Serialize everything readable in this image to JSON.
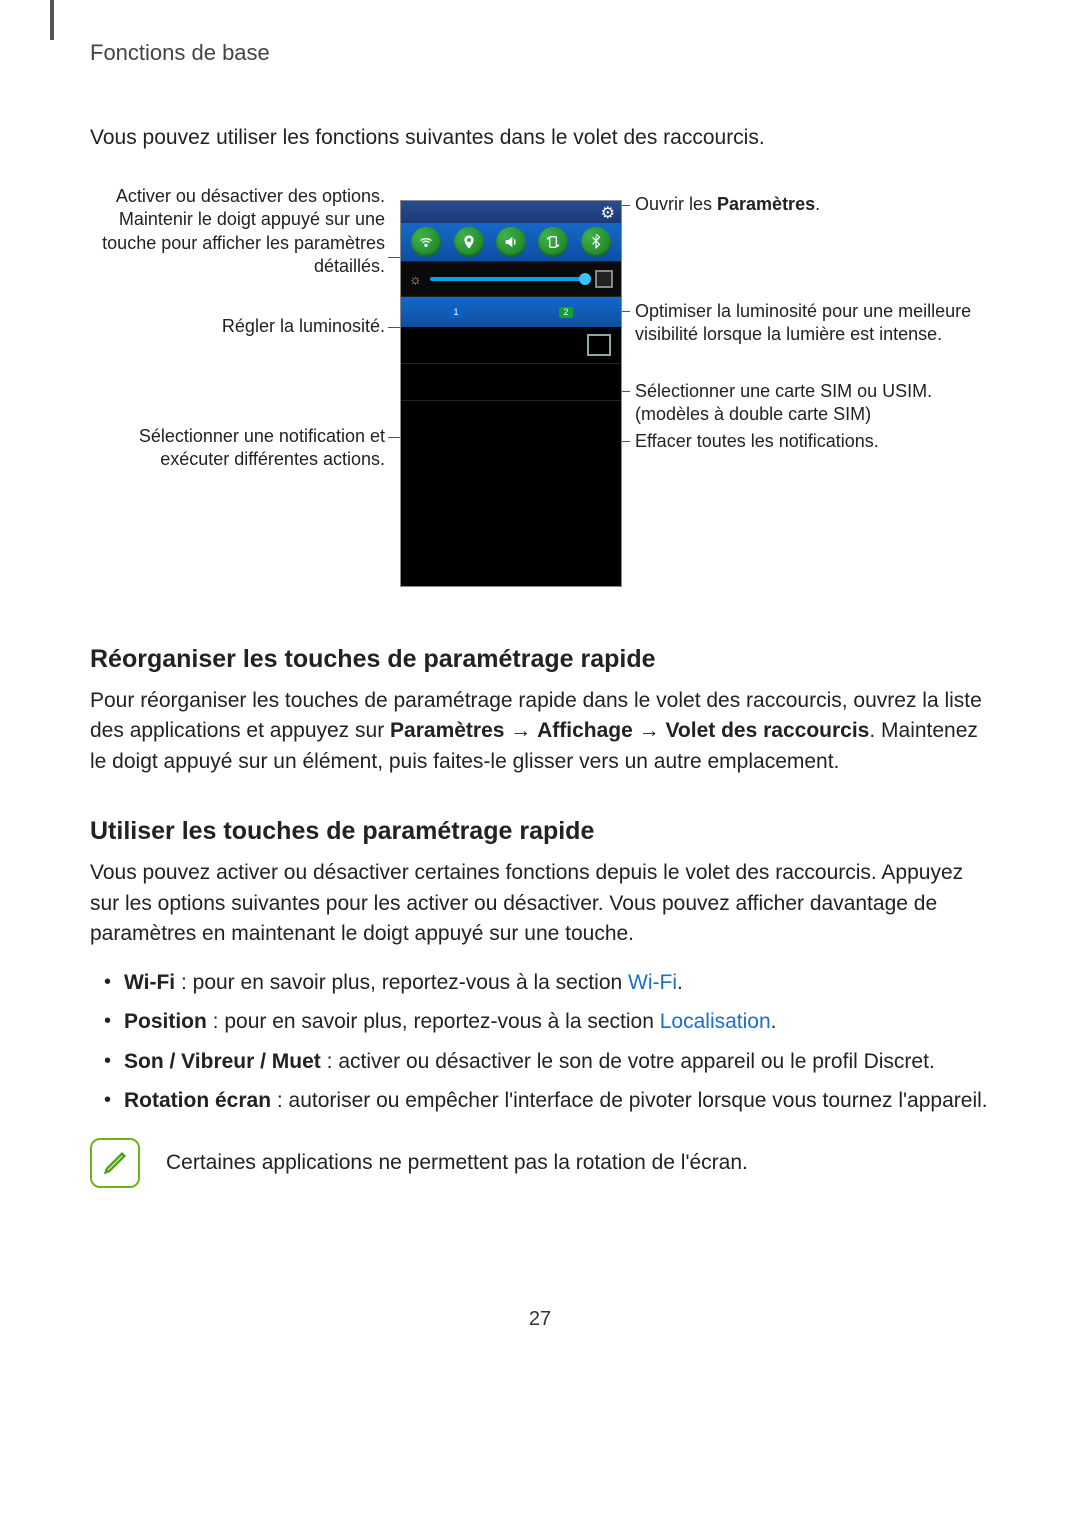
{
  "header": "Fonctions de base",
  "intro": "Vous pouvez utiliser les fonctions suivantes dans le volet des raccourcis.",
  "callouts": {
    "left_toggles": "Activer ou désactiver des options. Maintenir le doigt appuyé sur une touche pour afficher les paramètres détaillés.",
    "left_brightness": "Régler la luminosité.",
    "left_notif": "Sélectionner une notification et exécuter différentes actions.",
    "right_settings_pre": "Ouvrir les ",
    "right_settings_strong": "Paramètres",
    "right_settings_post": ".",
    "right_bright": "Optimiser la luminosité pour une meilleure visibilité lorsque la lumière est intense.",
    "right_sim": "Sélectionner une carte SIM ou USIM. (modèles à double carte SIM)",
    "right_clear": "Effacer toutes les notifications."
  },
  "sim": {
    "one": "1",
    "two": "2"
  },
  "h1": "Réorganiser les touches de paramétrage rapide",
  "p1_a": "Pour réorganiser les touches de paramétrage rapide dans le volet des raccourcis, ouvrez la liste des applications et appuyez sur ",
  "p1_b": "Paramètres",
  "p1_c": " → ",
  "p1_d": "Affichage",
  "p1_e": " → ",
  "p1_f": "Volet des raccourcis",
  "p1_g": ". Maintenez le doigt appuyé sur un élément, puis faites-le glisser vers un autre emplacement.",
  "h2": "Utiliser les touches de paramétrage rapide",
  "p2": "Vous pouvez activer ou désactiver certaines fonctions depuis le volet des raccourcis. Appuyez sur les options suivantes pour les activer ou désactiver. Vous pouvez afficher davantage de paramètres en maintenant le doigt appuyé sur une touche.",
  "bullets": {
    "b1_strong": "Wi-Fi",
    "b1_text": " : pour en savoir plus, reportez-vous à la section ",
    "b1_link": "Wi-Fi",
    "b1_end": ".",
    "b2_strong": "Position",
    "b2_text": " : pour en savoir plus, reportez-vous à la section ",
    "b2_link": "Localisation",
    "b2_end": ".",
    "b3_strong": "Son / Vibreur / Muet",
    "b3_text": " : activer ou désactiver le son de votre appareil ou le profil Discret.",
    "b4_strong": "Rotation écran",
    "b4_text": " : autoriser ou empêcher l'interface de pivoter lorsque vous tournez l'appareil."
  },
  "note": "Certaines applications ne permettent pas la rotation de l'écran.",
  "page_number": "27"
}
